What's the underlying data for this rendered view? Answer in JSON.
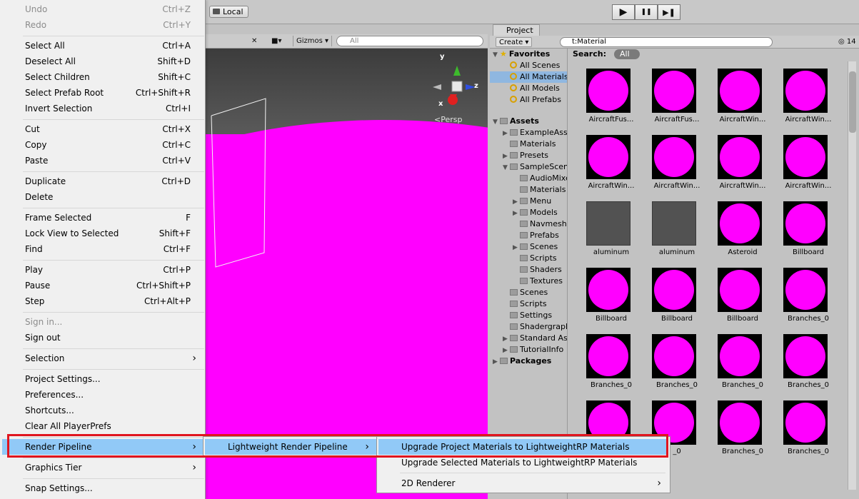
{
  "toolbar": {
    "local_label": "Local",
    "play": "▶",
    "pause": "❚❚",
    "step": "▶❚"
  },
  "scene": {
    "gizmos_label": "Gizmos",
    "search_placeholder": "All",
    "persp_label": "Persp",
    "axis_y": "y",
    "axis_z": "z",
    "axis_x": "x"
  },
  "project": {
    "tab_label": "Project",
    "create_label": "Create",
    "search_value": "t:Material",
    "count": "14",
    "search_label": "Search:",
    "search_scope": "All",
    "tree": {
      "favorites": "Favorites",
      "fav_items": [
        "All Scenes",
        "All Materials",
        "All Models",
        "All Prefabs"
      ],
      "assets": "Assets",
      "asset_items": [
        "ExampleAssets",
        "Materials",
        "Presets",
        "SampleScenes",
        "AudioMixers",
        "Materials",
        "Menu",
        "Models",
        "Navmesh",
        "Prefabs",
        "Scenes",
        "Scripts",
        "Shaders",
        "Textures",
        "Scenes",
        "Scripts",
        "Settings",
        "Shadergraph",
        "Standard Assets",
        "TutorialInfo"
      ],
      "packages": "Packages"
    },
    "tiles": [
      "AircraftFus...",
      "AircraftFus...",
      "AircraftWin...",
      "AircraftWin...",
      "AircraftWin...",
      "AircraftWin...",
      "AircraftWin...",
      "AircraftWin...",
      "aluminum",
      "aluminum",
      "Asteroid",
      "Billboard",
      "Billboard",
      "Billboard",
      "Billboard",
      "Branches_0",
      "Branches_0",
      "Branches_0",
      "Branches_0",
      "Branches_0",
      "",
      "_0",
      "Branches_0",
      "Branches_0"
    ]
  },
  "menu": {
    "items": [
      {
        "label": "Undo",
        "shortcut": "Ctrl+Z"
      },
      {
        "label": "Redo",
        "shortcut": "Ctrl+Y"
      },
      {
        "label": "Select All",
        "shortcut": "Ctrl+A"
      },
      {
        "label": "Deselect All",
        "shortcut": "Shift+D"
      },
      {
        "label": "Select Children",
        "shortcut": "Shift+C"
      },
      {
        "label": "Select Prefab Root",
        "shortcut": "Ctrl+Shift+R"
      },
      {
        "label": "Invert Selection",
        "shortcut": "Ctrl+I"
      },
      {
        "label": "Cut",
        "shortcut": "Ctrl+X"
      },
      {
        "label": "Copy",
        "shortcut": "Ctrl+C"
      },
      {
        "label": "Paste",
        "shortcut": "Ctrl+V"
      },
      {
        "label": "Duplicate",
        "shortcut": "Ctrl+D"
      },
      {
        "label": "Delete",
        "shortcut": ""
      },
      {
        "label": "Frame Selected",
        "shortcut": "F"
      },
      {
        "label": "Lock View to Selected",
        "shortcut": "Shift+F"
      },
      {
        "label": "Find",
        "shortcut": "Ctrl+F"
      },
      {
        "label": "Play",
        "shortcut": "Ctrl+P"
      },
      {
        "label": "Pause",
        "shortcut": "Ctrl+Shift+P"
      },
      {
        "label": "Step",
        "shortcut": "Ctrl+Alt+P"
      },
      {
        "label": "Sign in...",
        "shortcut": ""
      },
      {
        "label": "Sign out",
        "shortcut": ""
      },
      {
        "label": "Selection",
        "shortcut": ""
      },
      {
        "label": "Project Settings...",
        "shortcut": ""
      },
      {
        "label": "Preferences...",
        "shortcut": ""
      },
      {
        "label": "Shortcuts...",
        "shortcut": ""
      },
      {
        "label": "Clear All PlayerPrefs",
        "shortcut": ""
      },
      {
        "label": "Render Pipeline",
        "shortcut": ""
      },
      {
        "label": "Graphics Tier",
        "shortcut": ""
      },
      {
        "label": "Snap Settings...",
        "shortcut": ""
      }
    ],
    "render_pipeline_sub": {
      "item": "Lightweight Render Pipeline"
    },
    "lightweight_sub": {
      "items": [
        "Upgrade Project Materials to LightweightRP Materials",
        "Upgrade Selected Materials to LightweightRP Materials",
        "2D Renderer"
      ]
    }
  },
  "colors": {
    "highlight": "#91c9f7",
    "material_missing": "#ff00ff",
    "callout": "#e0151f"
  }
}
